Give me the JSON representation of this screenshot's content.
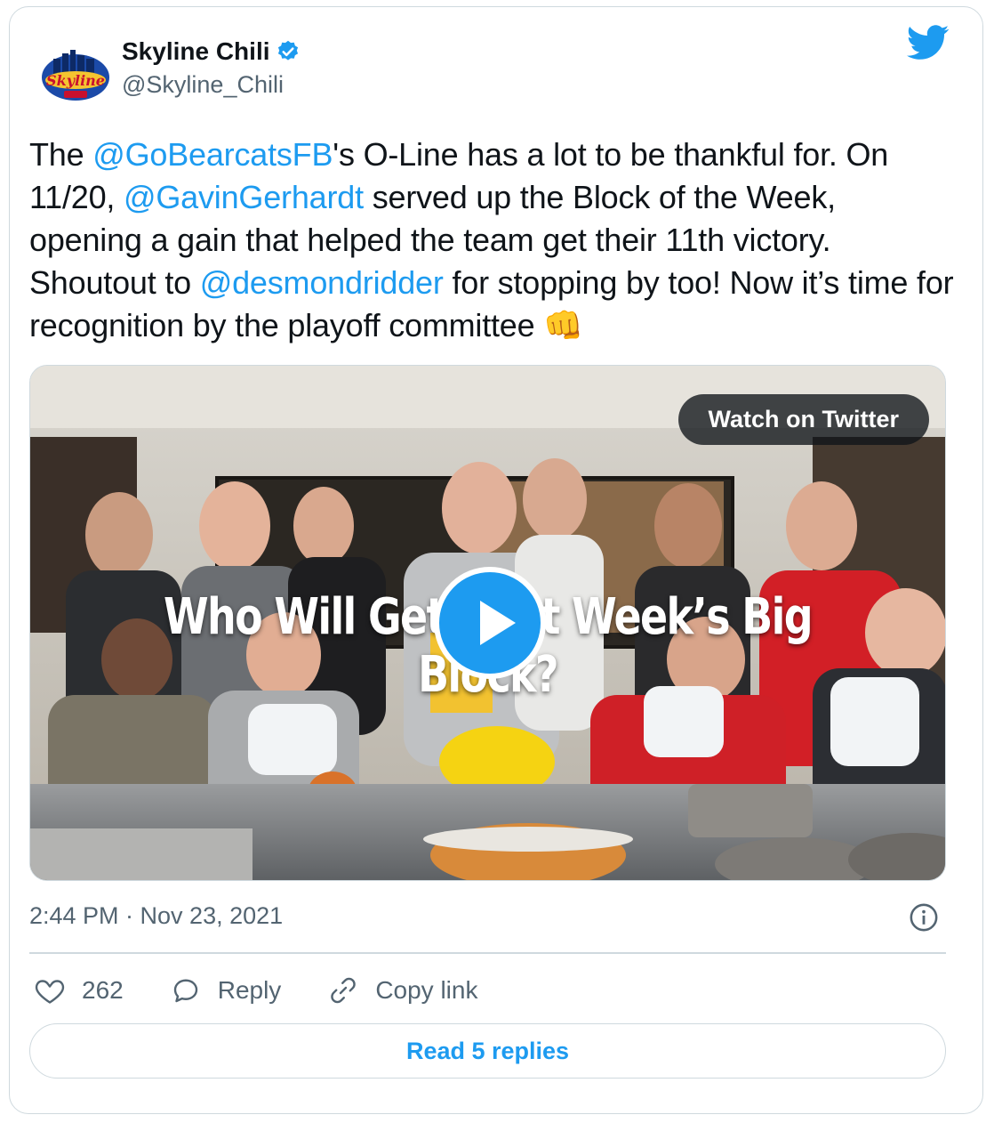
{
  "author": {
    "display_name": "Skyline Chili",
    "handle": "@Skyline_Chili",
    "avatar_text": "Skyline"
  },
  "tweet": {
    "segments": [
      {
        "text": "The ",
        "type": "text"
      },
      {
        "text": "@GoBearcatsFB",
        "type": "mention"
      },
      {
        "text": "'s O-Line has a lot to be thankful for. On 11/20, ",
        "type": "text"
      },
      {
        "text": "@GavinGerhardt",
        "type": "mention"
      },
      {
        "text": " served up the Block of the Week, opening a gain that helped the team get their 11th victory. Shoutout to ",
        "type": "text"
      },
      {
        "text": "@desmondridder",
        "type": "mention"
      },
      {
        "text": " for stopping by too! Now it’s time for recognition by the playoff committee ",
        "type": "text"
      },
      {
        "text": "👊",
        "type": "emoji"
      }
    ]
  },
  "media": {
    "watch_label": "Watch on Twitter",
    "overlay_text": "Who Will Get Next Week’s Big Block?"
  },
  "timestamp": "2:44 PM · Nov 23, 2021",
  "actions": {
    "like_count": "262",
    "reply_label": "Reply",
    "copy_label": "Copy link"
  },
  "read_replies_label": "Read 5 replies",
  "colors": {
    "accent": "#1d9bf0",
    "text": "#0f1419",
    "secondary": "#536471",
    "border": "#cfd9de"
  }
}
